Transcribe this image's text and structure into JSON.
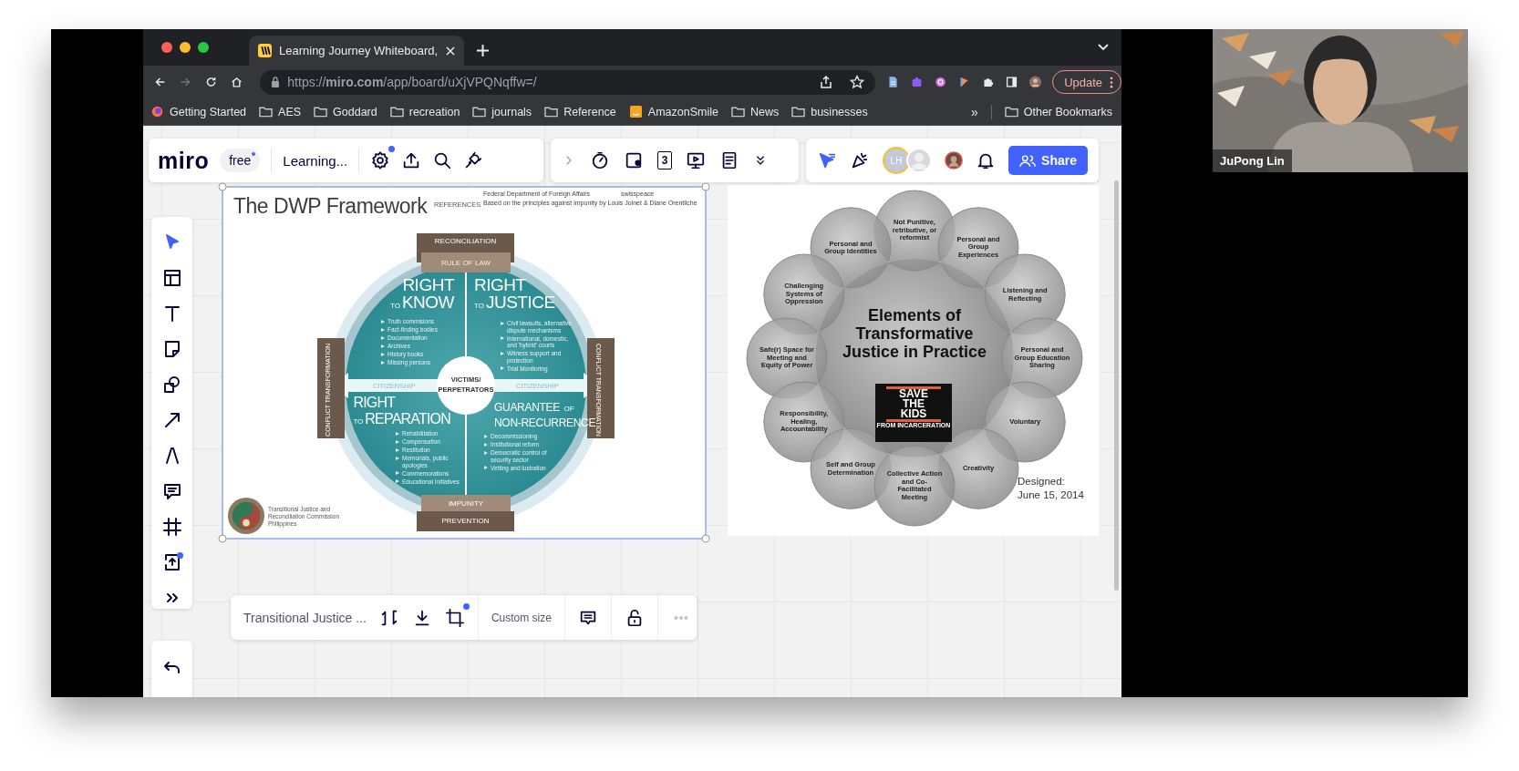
{
  "browser": {
    "tab_title": "Learning Journey Whiteboard,",
    "nav": [
      {
        "kind": "back",
        "disabled": false
      },
      {
        "kind": "forward",
        "disabled": true
      },
      {
        "kind": "reload",
        "disabled": false
      },
      {
        "kind": "home",
        "disabled": false
      }
    ],
    "url": "https://**miro.com**/app/board/uXjVPQNqffw=/",
    "update_button": "Update",
    "bookmarks": [
      {
        "label": "Getting Started",
        "kind": "site"
      },
      {
        "label": "AES",
        "kind": "folder"
      },
      {
        "label": "Goddard",
        "kind": "folder"
      },
      {
        "label": "recreation",
        "kind": "folder"
      },
      {
        "label": "journals",
        "kind": "folder"
      },
      {
        "label": "Reference",
        "kind": "folder"
      },
      {
        "label": "AmazonSmile",
        "kind": "shop"
      },
      {
        "label": "News",
        "kind": "folder"
      },
      {
        "label": "businesses",
        "kind": "folder"
      }
    ],
    "bookmarks_overflow": "»",
    "other_bookmarks": "Other Bookmarks"
  },
  "miro": {
    "logo": "miro",
    "plan": "free",
    "board_name": "Learning...",
    "counter_label": "3",
    "avatar_initials": "LH",
    "share_button": "Share",
    "tools": [
      {
        "kind": "select",
        "selected": true
      },
      {
        "kind": "templates",
        "selected": false
      },
      {
        "kind": "text",
        "selected": false
      },
      {
        "kind": "sticky",
        "selected": false
      },
      {
        "kind": "shapes",
        "selected": false
      },
      {
        "kind": "line",
        "selected": false
      },
      {
        "kind": "pen",
        "selected": false
      },
      {
        "kind": "comment",
        "selected": false
      },
      {
        "kind": "frame",
        "selected": false
      },
      {
        "kind": "upload",
        "selected": false
      },
      {
        "kind": "more",
        "selected": false
      }
    ],
    "context_toolbar": {
      "item_name": "Transitional Justice ...",
      "size": "Custom size"
    },
    "dwp": {
      "title": "The DWP Framework",
      "references_label": "REFERENCES",
      "reference_source": "Federal Department of Foreign Affairs",
      "reference_partner": "swisspeace",
      "reference_note": "Based on the principles against impunity by Louis Joinet & Diane Orentliche",
      "top_labels": [
        "RECONCILIATION",
        "RULE OF LAW"
      ],
      "bottom_labels": [
        "IMPUNITY",
        "PREVENTION"
      ],
      "side_labels": [
        "CONFLICT TRANSFORMATION",
        "CONFLICT TRANSFORMATION"
      ],
      "band_labels": [
        "CITIZENSHIP",
        "CITIZENSHIP"
      ],
      "center_label": "VICTIMS/ PERPETRATORS",
      "quadrants": [
        {
          "kind": "right",
          "line1": "RIGHT",
          "joiner": "TO",
          "line2": "KNOW",
          "items": [
            "Truth commisions",
            "Fact-finding bodies",
            "Documentation",
            "Archives",
            "History books",
            "Missing persons"
          ]
        },
        {
          "kind": "right",
          "line1": "RIGHT",
          "joiner": "TO",
          "line2": "JUSTICE",
          "items": [
            "Civil lawsuits, alternative dispute mechanisms",
            "International, domestic, and 'hybrid' courts",
            "Witness support and protection",
            "Trial Monitoring"
          ]
        },
        {
          "kind": "right",
          "line1": "RIGHT",
          "joiner": "TO",
          "line2": "REPARATION",
          "items": [
            "Rehabilitation",
            "Compensation",
            "Restitution",
            "Memorials, public apologies",
            "Commemorations",
            "Educational Initiatives"
          ]
        },
        {
          "kind": "guarantee",
          "line1": "GUARANTEE",
          "joiner": "OF",
          "line2": "NON-RECURRENCE",
          "items": [
            "Decommissioning",
            "Institutional reform",
            "Democratic control of security sector",
            "Vetting and lustration"
          ]
        }
      ],
      "organization": "Transitional Justice and Reconciliation Commission Philippines"
    },
    "elements": {
      "title": "Elements of Transformative Justice in Practice",
      "logo_lines": [
        "SAVE",
        "THE",
        "KIDS"
      ],
      "logo_tagline": "FROM INCARCERATION",
      "petals": [
        "Not Punitive, retributive, or reformist",
        "Personal and Group Identities",
        "Personal and Group Experiences",
        "Challenging Systems of Oppression",
        "Listening and Reflecting",
        "Safe(r) Space for Meeting and Equity of Power",
        "Personal and Group Education Sharing",
        "Responsibility, Healing, Accountability",
        "Voluntary",
        "Self and Group Determination",
        "Creativity",
        "Collective Action and Co-Facilitated Meeting"
      ],
      "designed_label": "Designed:",
      "designed_date": "June 15, 2014"
    }
  },
  "video": {
    "kind": "picture",
    "participant": "JuPong Lin"
  }
}
